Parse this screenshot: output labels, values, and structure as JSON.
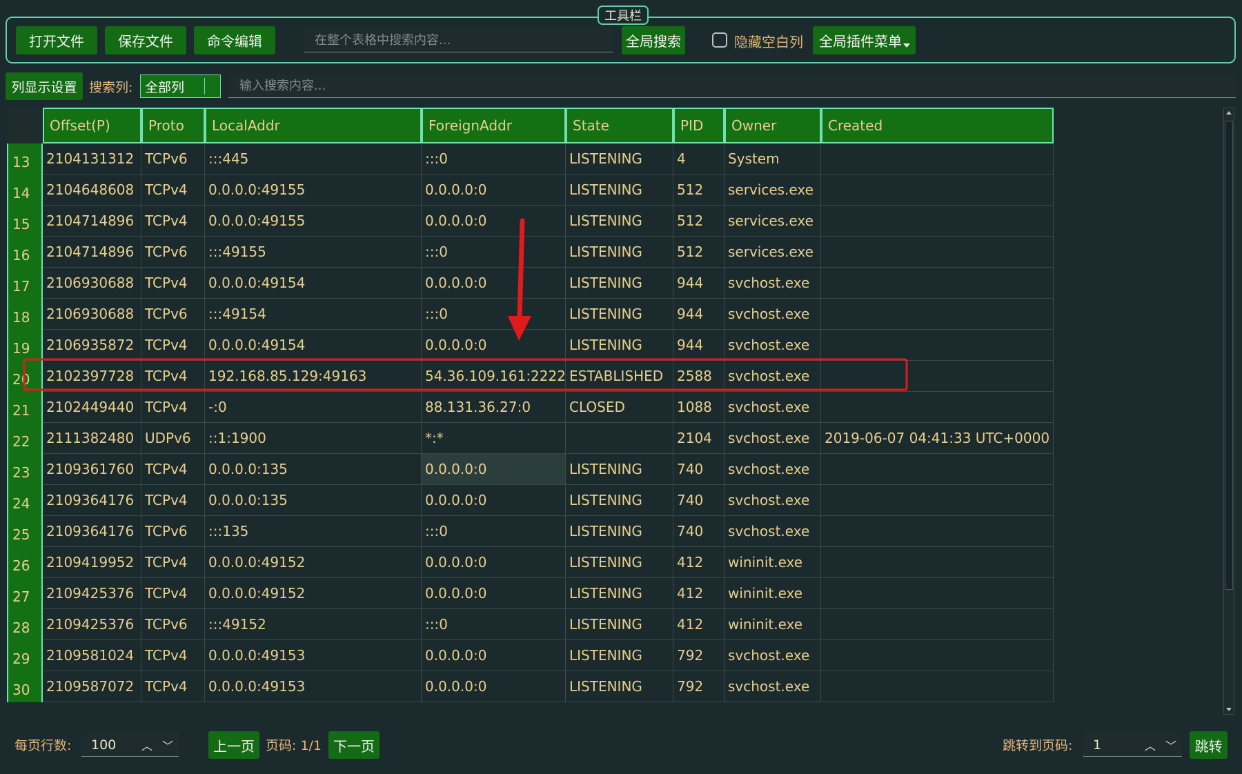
{
  "toolbar": {
    "title": "工具栏",
    "open_file": "打开文件",
    "save_file": "保存文件",
    "command_edit": "命令编辑",
    "global_search_placeholder": "在整个表格中搜索内容...",
    "global_search_button": "全局搜索",
    "hide_empty_cols": "隐藏空白列",
    "plugin_menu": "全局插件菜单"
  },
  "filter": {
    "col_settings": "列显示设置",
    "search_col_label": "搜索列:",
    "search_col_value": "全部列",
    "search_placeholder": "输入搜索内容..."
  },
  "table": {
    "columns": [
      "Offset(P)",
      "Proto",
      "LocalAddr",
      "ForeignAddr",
      "State",
      "PID",
      "Owner",
      "Created"
    ],
    "rows": [
      [
        "13",
        "2104131312",
        "TCPv6",
        ":::445",
        ":::0",
        "LISTENING",
        "4",
        "System",
        ""
      ],
      [
        "14",
        "2104648608",
        "TCPv4",
        "0.0.0.0:49155",
        "0.0.0.0:0",
        "LISTENING",
        "512",
        "services.exe",
        ""
      ],
      [
        "15",
        "2104714896",
        "TCPv4",
        "0.0.0.0:49155",
        "0.0.0.0:0",
        "LISTENING",
        "512",
        "services.exe",
        ""
      ],
      [
        "16",
        "2104714896",
        "TCPv6",
        ":::49155",
        ":::0",
        "LISTENING",
        "512",
        "services.exe",
        ""
      ],
      [
        "17",
        "2106930688",
        "TCPv4",
        "0.0.0.0:49154",
        "0.0.0.0:0",
        "LISTENING",
        "944",
        "svchost.exe",
        ""
      ],
      [
        "18",
        "2106930688",
        "TCPv6",
        ":::49154",
        ":::0",
        "LISTENING",
        "944",
        "svchost.exe",
        ""
      ],
      [
        "19",
        "2106935872",
        "TCPv4",
        "0.0.0.0:49154",
        "0.0.0.0:0",
        "LISTENING",
        "944",
        "svchost.exe",
        ""
      ],
      [
        "20",
        "2102397728",
        "TCPv4",
        "192.168.85.129:49163",
        "54.36.109.161:2222",
        "ESTABLISHED",
        "2588",
        "svchost.exe",
        ""
      ],
      [
        "21",
        "2102449440",
        "TCPv4",
        "-:0",
        "88.131.36.27:0",
        "CLOSED",
        "1088",
        "svchost.exe",
        ""
      ],
      [
        "22",
        "2111382480",
        "UDPv6",
        "::1:1900",
        "*:*",
        "",
        "2104",
        "svchost.exe",
        "2019-06-07 04:41:33 UTC+0000"
      ],
      [
        "23",
        "2109361760",
        "TCPv4",
        "0.0.0.0:135",
        "0.0.0.0:0",
        "LISTENING",
        "740",
        "svchost.exe",
        ""
      ],
      [
        "24",
        "2109364176",
        "TCPv4",
        "0.0.0.0:135",
        "0.0.0.0:0",
        "LISTENING",
        "740",
        "svchost.exe",
        ""
      ],
      [
        "25",
        "2109364176",
        "TCPv6",
        ":::135",
        ":::0",
        "LISTENING",
        "740",
        "svchost.exe",
        ""
      ],
      [
        "26",
        "2109419952",
        "TCPv4",
        "0.0.0.0:49152",
        "0.0.0.0:0",
        "LISTENING",
        "412",
        "wininit.exe",
        ""
      ],
      [
        "27",
        "2109425376",
        "TCPv4",
        "0.0.0.0:49152",
        "0.0.0.0:0",
        "LISTENING",
        "412",
        "wininit.exe",
        ""
      ],
      [
        "28",
        "2109425376",
        "TCPv6",
        ":::49152",
        ":::0",
        "LISTENING",
        "412",
        "wininit.exe",
        ""
      ],
      [
        "29",
        "2109581024",
        "TCPv4",
        "0.0.0.0:49153",
        "0.0.0.0:0",
        "LISTENING",
        "792",
        "svchost.exe",
        ""
      ],
      [
        "30",
        "2109587072",
        "TCPv4",
        "0.0.0.0:49153",
        "0.0.0.0:0",
        "LISTENING",
        "792",
        "svchost.exe",
        ""
      ]
    ],
    "selected_cell": "0.0.0.0:0"
  },
  "pager": {
    "rows_per_page_label": "每页行数:",
    "rows_per_page": "100",
    "prev": "上一页",
    "page_info": "页码: 1/1",
    "next": "下一页",
    "goto_label": "跳转到页码:",
    "goto_value": "1",
    "goto_button": "跳转"
  },
  "colors": {
    "highlight_box": "#e01b1b",
    "arrow": "#e01b1b",
    "header_bg": "#147014",
    "accent_border": "#6fe0b0"
  }
}
